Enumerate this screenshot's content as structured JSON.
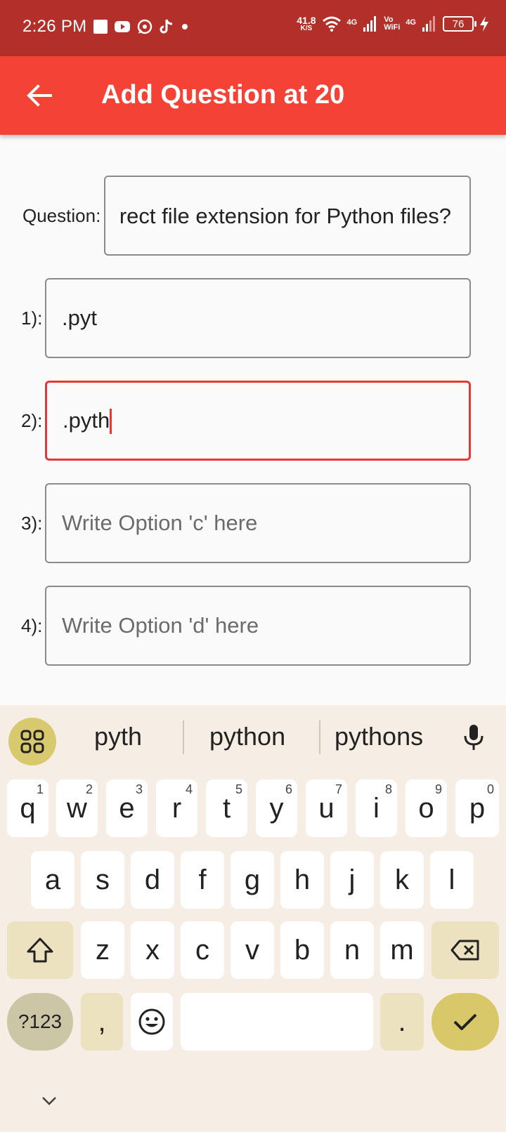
{
  "status_bar": {
    "time": "2:26 PM",
    "net_speed_value": "41.8",
    "net_speed_unit": "K/S",
    "sim1_label": "4G",
    "vowifi_line1": "Vo",
    "vowifi_line2": "WiFi",
    "sim2_label": "4G",
    "battery": "76",
    "notification_icons": [
      "square-icon",
      "youtube-icon",
      "whatsapp-icon",
      "tiktok-icon",
      "dot-icon"
    ]
  },
  "app_bar": {
    "title": "Add Question at 20"
  },
  "form": {
    "question_label": "Question:",
    "question_value": "rect file extension for Python files?",
    "options": [
      {
        "label": "1):",
        "value": ".pyt",
        "placeholder": ""
      },
      {
        "label": "2):",
        "value": ".pyth",
        "placeholder": ""
      },
      {
        "label": "3):",
        "value": "",
        "placeholder": "Write Option 'c' here"
      },
      {
        "label": "4):",
        "value": "",
        "placeholder": "Write Option 'd' here"
      }
    ],
    "focused_option": 2
  },
  "keyboard": {
    "suggestions": [
      "pyth",
      "python",
      "pythons"
    ],
    "row1": [
      {
        "k": "q",
        "h": "1"
      },
      {
        "k": "w",
        "h": "2"
      },
      {
        "k": "e",
        "h": "3"
      },
      {
        "k": "r",
        "h": "4"
      },
      {
        "k": "t",
        "h": "5"
      },
      {
        "k": "y",
        "h": "6"
      },
      {
        "k": "u",
        "h": "7"
      },
      {
        "k": "i",
        "h": "8"
      },
      {
        "k": "o",
        "h": "9"
      },
      {
        "k": "p",
        "h": "0"
      }
    ],
    "row2": [
      "a",
      "s",
      "d",
      "f",
      "g",
      "h",
      "j",
      "k",
      "l"
    ],
    "row3": [
      "z",
      "x",
      "c",
      "v",
      "b",
      "n",
      "m"
    ],
    "symbols_label": "?123",
    "comma": ",",
    "period": ".",
    "accent_color": "#d9c86a"
  },
  "colors": {
    "status_bar": "#b3302a",
    "app_bar": "#f44336",
    "focus_border": "#e53935"
  }
}
